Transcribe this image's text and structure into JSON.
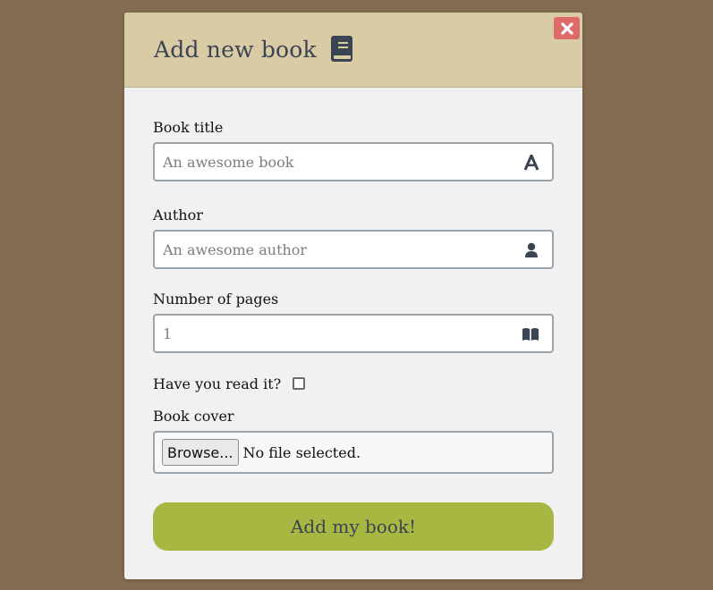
{
  "modal": {
    "title": "Add new book",
    "close_label": "✖"
  },
  "fields": {
    "title": {
      "label": "Book title",
      "placeholder": "An awesome book"
    },
    "author": {
      "label": "Author",
      "placeholder": "An awesome author"
    },
    "pages": {
      "label": "Number of pages",
      "value": "1"
    },
    "read": {
      "label": "Have you read it?"
    },
    "cover": {
      "label": "Book cover",
      "browse_label": "Browse...",
      "status": "No file selected."
    }
  },
  "submit_label": "Add my book!",
  "colors": {
    "background": "#846c52",
    "header": "#d9cba4",
    "submit": "#a7b741",
    "close": "#dd6b6a",
    "icon": "#3a4452"
  },
  "icons": {
    "header": "book-icon",
    "title_field": "font-icon",
    "author_field": "user-icon",
    "pages_field": "open-book-icon",
    "close": "close-icon"
  }
}
